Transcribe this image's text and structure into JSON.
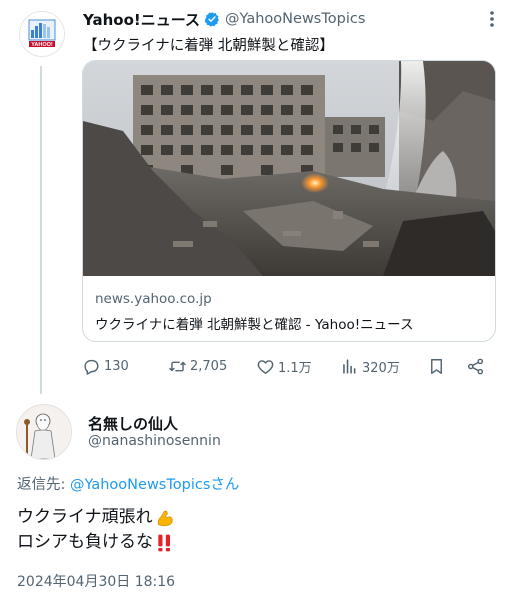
{
  "tweet1": {
    "name": "Yahoo!ニュース",
    "handle": "@YahooNewsTopics",
    "text": "【ウクライナに着弾 北朝鮮製と確認】",
    "avatar_icon": "yahoo-news-logo-icon",
    "avatar_logo_text": "YAHOO!",
    "card": {
      "domain": "news.yahoo.co.jp",
      "title": "ウクライナに着弾 北朝鮮製と確認 - Yahoo!ニュース"
    },
    "actions": {
      "replies": "130",
      "retweets": "2,705",
      "likes": "1.1万",
      "views": "320万"
    }
  },
  "tweet2": {
    "name": "名無しの仙人",
    "handle": "@nanashinosennin",
    "reply_prefix": "返信先: ",
    "reply_handle": "@YahooNewsTopics",
    "reply_suffix": "さん",
    "line1": "ウクライナ頑張れ",
    "line2": "ロシアも負けるな",
    "line1_emoji": "flexed-biceps-icon",
    "line2_emoji": "double-exclamation-icon",
    "timestamp": "2024年04月30日 18:16"
  },
  "colors": {
    "accent": "#1d9bf0",
    "secondary_text": "#536471",
    "border": "#cfd9de"
  }
}
